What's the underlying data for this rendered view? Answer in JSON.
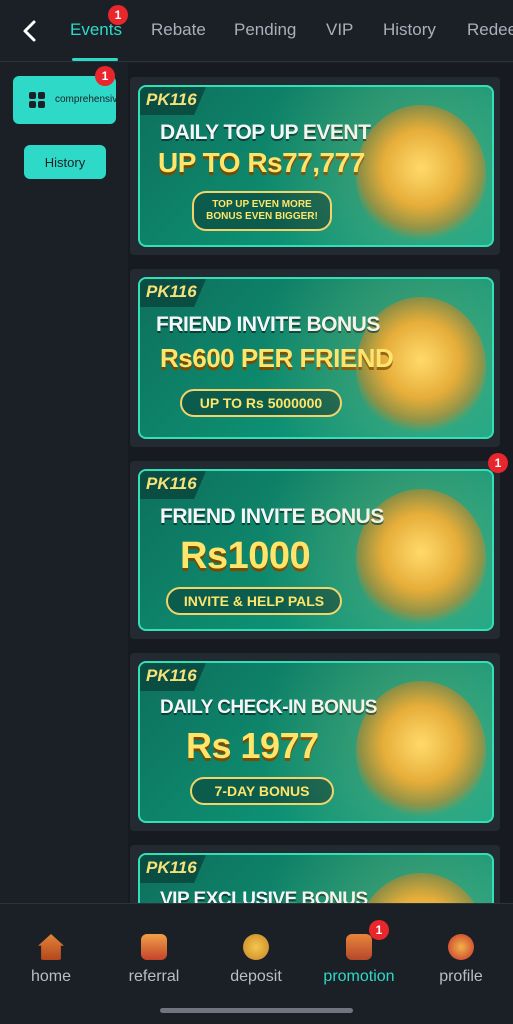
{
  "header": {
    "tabs": [
      {
        "label": "Events",
        "badge": "1"
      },
      {
        "label": "Rebate"
      },
      {
        "label": "Pending"
      },
      {
        "label": "VIP"
      },
      {
        "label": "History"
      },
      {
        "label": "Redee"
      }
    ]
  },
  "sidebar": {
    "comprehensive": {
      "label": "comprehensive",
      "badge": "1"
    },
    "history": {
      "label": "History"
    }
  },
  "banners": [
    {
      "brand": "PK116",
      "line1": "DAILY TOP UP EVENT",
      "line2": "UP TO Rs77,777",
      "pill": "TOP UP EVEN MORE BONUS EVEN BIGGER!"
    },
    {
      "brand": "PK116",
      "line1": "FRIEND INVITE BONUS",
      "line2": "Rs600 PER FRIEND",
      "pill": "UP TO Rs 5000000"
    },
    {
      "brand": "PK116",
      "line1": "FRIEND INVITE BONUS",
      "line2": "Rs1000",
      "pill": "INVITE & HELP PALS",
      "badge": "1"
    },
    {
      "brand": "PK116",
      "line1": "DAILY CHECK-IN BONUS",
      "line2": "Rs 1977",
      "pill": "7-DAY BONUS"
    },
    {
      "brand": "PK116",
      "line1": "VIP EXCLUSIVE BONUS"
    }
  ],
  "bottom_nav": [
    {
      "label": "home",
      "icon": "home-icon"
    },
    {
      "label": "referral",
      "icon": "referral-icon"
    },
    {
      "label": "deposit",
      "icon": "deposit-icon"
    },
    {
      "label": "promotion",
      "icon": "promotion-icon",
      "badge": "1",
      "active": true
    },
    {
      "label": "profile",
      "icon": "profile-icon"
    }
  ],
  "colors": {
    "accent": "#2fd9c7",
    "badge": "#e8262c",
    "background": "#1b2027"
  }
}
